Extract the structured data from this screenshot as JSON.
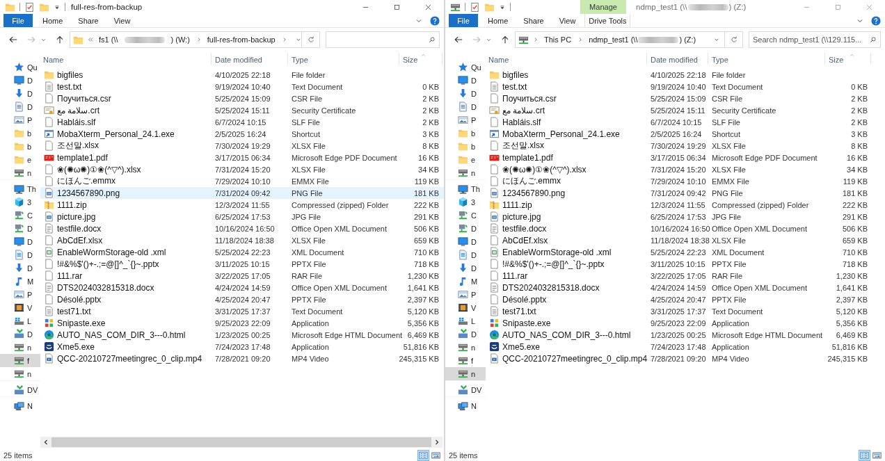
{
  "windows": [
    {
      "kind": "folder",
      "active": true,
      "title": {
        "text_start": "full-res-from-backup"
      },
      "ribbon_tabs": [
        {
          "label": "File",
          "kind": "file"
        },
        {
          "label": "Home",
          "kind": "tab"
        },
        {
          "label": "Share",
          "kind": "tab"
        },
        {
          "label": "View",
          "kind": "tab"
        }
      ],
      "address": {
        "crumbs": [
          {
            "text_start": "fs1 (\\\\",
            "redacted": true,
            "text_end": ") (W:)",
            "chevron_after": true
          },
          {
            "text_start": "full-res-from-backup",
            "redacted": false,
            "chevron_after": true
          }
        ]
      },
      "nav": [
        {
          "label": "Qu",
          "kind": "star",
          "selected": false
        },
        {
          "label": "D",
          "kind": "desktop",
          "selected": false
        },
        {
          "label": "D",
          "kind": "download",
          "selected": false
        },
        {
          "label": "D",
          "kind": "docs",
          "selected": false
        },
        {
          "label": "P",
          "kind": "pictures",
          "selected": false
        },
        {
          "label": "b",
          "kind": "folder",
          "selected": false
        },
        {
          "label": "b",
          "kind": "folder",
          "selected": false
        },
        {
          "label": "e",
          "kind": "folder",
          "selected": false
        },
        {
          "label": "n",
          "kind": "netdrive",
          "selected": false
        },
        {
          "label": "Th",
          "kind": "pc",
          "selected": false,
          "group_start": true
        },
        {
          "label": "3",
          "kind": "cube",
          "selected": false
        },
        {
          "label": "C",
          "kind": "share",
          "selected": false
        },
        {
          "label": "D",
          "kind": "share",
          "selected": false
        },
        {
          "label": "D",
          "kind": "desktop",
          "selected": false
        },
        {
          "label": "D",
          "kind": "docs",
          "selected": false
        },
        {
          "label": "D",
          "kind": "download",
          "selected": false
        },
        {
          "label": "M",
          "kind": "music",
          "selected": false
        },
        {
          "label": "P",
          "kind": "pictures",
          "selected": false
        },
        {
          "label": "V",
          "kind": "video",
          "selected": false
        },
        {
          "label": "L",
          "kind": "local",
          "selected": false
        },
        {
          "label": "D",
          "kind": "dvd",
          "selected": false
        },
        {
          "label": "n",
          "kind": "netdrive",
          "selected": false
        },
        {
          "label": "f",
          "kind": "netdrive",
          "selected": true
        },
        {
          "label": "n",
          "kind": "netdrive",
          "selected": false
        },
        {
          "label": "DV",
          "kind": "dvd",
          "selected": false,
          "group_start": true
        },
        {
          "label": "N",
          "kind": "network",
          "selected": false,
          "group_start": true
        }
      ],
      "columns": [
        {
          "label": "Name",
          "sorted": false
        },
        {
          "label": "Date modified",
          "sorted": false
        },
        {
          "label": "Type",
          "sorted": false
        },
        {
          "label": "Size",
          "sorted": true
        }
      ],
      "rows": [
        {
          "kind": "folder",
          "name": "bigfiles",
          "date": "4/10/2025 22:18",
          "type": "File folder",
          "selected": false
        },
        {
          "kind": "text",
          "name": "test.txt",
          "date": "9/19/2024 10:40",
          "type": "Text Document",
          "size": "0 KB",
          "selected": false
        },
        {
          "kind": "blank",
          "name": "Поучиться.csr",
          "date": "5/25/2024 15:09",
          "type": "CSR File",
          "size": "2 KB",
          "selected": false
        },
        {
          "kind": "cert",
          "name": "سلامة مع.crt",
          "date": "5/25/2024 15:11",
          "type": "Security Certificate",
          "size": "2 KB",
          "selected": false
        },
        {
          "kind": "blank",
          "name": "Habláis.slf",
          "date": "6/7/2024 10:15",
          "type": "SLF File",
          "size": "2 KB",
          "selected": false
        },
        {
          "kind": "shortcut",
          "name": "MobaXterm_Personal_24.1.exe",
          "date": "2/5/2025 16:24",
          "type": "Shortcut",
          "size": "3 KB",
          "selected": false
        },
        {
          "kind": "blank",
          "name": "조선말.xlsx",
          "date": "7/30/2024 19:29",
          "type": "XLSX File",
          "size": "8 KB",
          "selected": false
        },
        {
          "kind": "pdf",
          "name": "template1.pdf",
          "date": "3/17/2015 06:34",
          "type": "Microsoft Edge PDF Document",
          "size": "16 KB",
          "selected": false
        },
        {
          "kind": "blank",
          "name": "❀(✺ω✺)①❀(^▽^).xlsx",
          "date": "7/31/2024 15:20",
          "type": "XLSX File",
          "size": "34 KB",
          "selected": false
        },
        {
          "kind": "blank",
          "name": "にほんご.emmx",
          "date": "7/29/2024 10:10",
          "type": "EMMX File",
          "size": "119 KB",
          "selected": false
        },
        {
          "kind": "image",
          "name": "1234567890.png",
          "date": "7/31/2024 09:42",
          "type": "PNG File",
          "size": "181 KB",
          "selected": true
        },
        {
          "kind": "zip",
          "name": "1111.zip",
          "date": "12/3/2024 11:55",
          "type": "Compressed (zipped) Folder",
          "size": "222 KB",
          "selected": false
        },
        {
          "kind": "image",
          "name": "picture.jpg",
          "date": "6/25/2024 17:53",
          "type": "JPG File",
          "size": "291 KB",
          "selected": false
        },
        {
          "kind": "doc",
          "name": "testfile.docx",
          "date": "10/16/2024 16:50",
          "type": "Office Open XML Document",
          "size": "506 KB",
          "selected": false
        },
        {
          "kind": "blank",
          "name": "AbCdEf.xlsx",
          "date": "11/18/2024 18:38",
          "type": "XLSX File",
          "size": "659 KB",
          "selected": false
        },
        {
          "kind": "xml",
          "name": "EnableWormStorage-old .xml",
          "date": "5/25/2024 22:23",
          "type": "XML Document",
          "size": "710 KB",
          "selected": false
        },
        {
          "kind": "blank",
          "name": "!#&%$'()+-.;=@[]^_`{}~.pptx",
          "date": "3/11/2025 10:15",
          "type": "PPTX File",
          "size": "718 KB",
          "selected": false
        },
        {
          "kind": "blank",
          "name": "111.rar",
          "date": "3/22/2025 17:05",
          "type": "RAR File",
          "size": "1,230 KB",
          "selected": false
        },
        {
          "kind": "doc",
          "name": "DTS2024032815318.docx",
          "date": "4/24/2024 14:59",
          "type": "Office Open XML Document",
          "size": "1,641 KB",
          "selected": false
        },
        {
          "kind": "blank",
          "name": "Désolé.pptx",
          "date": "4/25/2024 20:47",
          "type": "PPTX File",
          "size": "2,397 KB",
          "selected": false
        },
        {
          "kind": "text",
          "name": "test71.txt",
          "date": "3/31/2025 17:37",
          "type": "Text Document",
          "size": "5,120 KB",
          "selected": false
        },
        {
          "kind": "snipaste",
          "name": "Snipaste.exe",
          "date": "9/25/2023 22:09",
          "type": "Application",
          "size": "5,356 KB",
          "selected": false
        },
        {
          "kind": "edge",
          "name": "AUTO_NAS_COM_DIR_3---0.html",
          "date": "1/23/2025 00:25",
          "type": "Microsoft Edge HTML Document",
          "size": "6,469 KB",
          "selected": false
        },
        {
          "kind": "xme",
          "name": "Xme5.exe",
          "date": "7/24/2023 17:48",
          "type": "Application",
          "size": "51,816 KB",
          "selected": false
        },
        {
          "kind": "video",
          "name": "QCC-20210727meetingrec_0_clip.mp4",
          "date": "7/28/2021 09:20",
          "type": "MP4 Video",
          "size": "245,315 KB",
          "selected": false
        }
      ],
      "hscroll": true,
      "status": "25 items",
      "view_buttons": [
        {
          "kind": "details",
          "selected": true
        },
        {
          "kind": "large_icons",
          "selected": false
        }
      ]
    },
    {
      "kind": "drive",
      "active": false,
      "title": {
        "text_start": "ndmp_test1 (\\\\",
        "text_end": ") (Z:)"
      },
      "ribbon_tabs": [
        {
          "label": "File",
          "kind": "file"
        },
        {
          "label": "Home",
          "kind": "tab"
        },
        {
          "label": "Share",
          "kind": "tab"
        },
        {
          "label": "View",
          "kind": "tab"
        },
        {
          "label": "Drive Tools",
          "kind": "tab",
          "context_label": "Manage"
        }
      ],
      "address": {
        "crumbs": [
          {
            "text_start": "This PC",
            "redacted": false,
            "chevron_after": true
          },
          {
            "text_start": "ndmp_test1 (\\\\",
            "redacted": true,
            "text_end": ") (Z:)",
            "chevron_after": false
          }
        ]
      },
      "search": {
        "placeholder": "Search ndmp_test1 (\\\\129.115..."
      },
      "nav": [
        {
          "label": "Qu",
          "kind": "star",
          "selected": false
        },
        {
          "label": "D",
          "kind": "desktop",
          "selected": false
        },
        {
          "label": "D",
          "kind": "download",
          "selected": false
        },
        {
          "label": "D",
          "kind": "docs",
          "selected": false
        },
        {
          "label": "P",
          "kind": "pictures",
          "selected": false
        },
        {
          "label": "b",
          "kind": "folder",
          "selected": false
        },
        {
          "label": "b",
          "kind": "folder",
          "selected": false
        },
        {
          "label": "e",
          "kind": "folder",
          "selected": false
        },
        {
          "label": "n",
          "kind": "netdrive",
          "selected": false
        },
        {
          "label": "Th",
          "kind": "pc",
          "selected": false,
          "group_start": true
        },
        {
          "label": "3",
          "kind": "cube",
          "selected": false
        },
        {
          "label": "C",
          "kind": "share",
          "selected": false
        },
        {
          "label": "D",
          "kind": "share",
          "selected": false
        },
        {
          "label": "D",
          "kind": "desktop",
          "selected": false
        },
        {
          "label": "D",
          "kind": "docs",
          "selected": false
        },
        {
          "label": "D",
          "kind": "download",
          "selected": false
        },
        {
          "label": "M",
          "kind": "music",
          "selected": false
        },
        {
          "label": "P",
          "kind": "pictures",
          "selected": false
        },
        {
          "label": "V",
          "kind": "video",
          "selected": false
        },
        {
          "label": "L",
          "kind": "local",
          "selected": false
        },
        {
          "label": "D",
          "kind": "dvd",
          "selected": false
        },
        {
          "label": "n",
          "kind": "netdrive",
          "selected": false
        },
        {
          "label": "f",
          "kind": "netdrive",
          "selected": false
        },
        {
          "label": "n",
          "kind": "netdrive",
          "selected": true
        },
        {
          "label": "DV",
          "kind": "dvd",
          "selected": false,
          "group_start": true
        },
        {
          "label": "N",
          "kind": "network",
          "selected": false,
          "group_start": true
        }
      ],
      "columns": [
        {
          "label": "Name",
          "sorted": false
        },
        {
          "label": "Date modified",
          "sorted": false
        },
        {
          "label": "Type",
          "sorted": false
        },
        {
          "label": "Size",
          "sorted": true
        }
      ],
      "rows": [
        {
          "kind": "folder",
          "name": "bigfiles",
          "date": "4/10/2025 22:18",
          "type": "File folder",
          "selected": false
        },
        {
          "kind": "text",
          "name": "test.txt",
          "date": "9/19/2024 10:40",
          "type": "Text Document",
          "size": "0 KB",
          "selected": false
        },
        {
          "kind": "blank",
          "name": "Поучиться.csr",
          "date": "5/25/2024 15:09",
          "type": "CSR File",
          "size": "2 KB",
          "selected": false
        },
        {
          "kind": "cert",
          "name": "سلامة مع.crt",
          "date": "5/25/2024 15:11",
          "type": "Security Certificate",
          "size": "2 KB",
          "selected": false
        },
        {
          "kind": "blank",
          "name": "Habláis.slf",
          "date": "6/7/2024 10:15",
          "type": "SLF File",
          "size": "2 KB",
          "selected": false
        },
        {
          "kind": "shortcut",
          "name": "MobaXterm_Personal_24.1.exe",
          "date": "2/5/2025 16:24",
          "type": "Shortcut",
          "size": "3 KB",
          "selected": false
        },
        {
          "kind": "blank",
          "name": "조선말.xlsx",
          "date": "7/30/2024 19:29",
          "type": "XLSX File",
          "size": "8 KB",
          "selected": false
        },
        {
          "kind": "pdf",
          "name": "template1.pdf",
          "date": "3/17/2015 06:34",
          "type": "Microsoft Edge PDF Document",
          "size": "16 KB",
          "selected": false
        },
        {
          "kind": "blank",
          "name": "❀(✺ω✺)①❀(^▽^).xlsx",
          "date": "7/31/2024 15:20",
          "type": "XLSX File",
          "size": "34 KB",
          "selected": false
        },
        {
          "kind": "blank",
          "name": "にほんご.emmx",
          "date": "7/29/2024 10:10",
          "type": "EMMX File",
          "size": "119 KB",
          "selected": false
        },
        {
          "kind": "image",
          "name": "1234567890.png",
          "date": "7/31/2024 09:42",
          "type": "PNG File",
          "size": "181 KB",
          "selected": false
        },
        {
          "kind": "zip",
          "name": "1111.zip",
          "date": "12/3/2024 11:55",
          "type": "Compressed (zipped) Folder",
          "size": "222 KB",
          "selected": false
        },
        {
          "kind": "image",
          "name": "picture.jpg",
          "date": "6/25/2024 17:53",
          "type": "JPG File",
          "size": "291 KB",
          "selected": false
        },
        {
          "kind": "doc",
          "name": "testfile.docx",
          "date": "10/16/2024 16:50",
          "type": "Office Open XML Document",
          "size": "506 KB",
          "selected": false
        },
        {
          "kind": "blank",
          "name": "AbCdEf.xlsx",
          "date": "11/18/2024 18:38",
          "type": "XLSX File",
          "size": "659 KB",
          "selected": false
        },
        {
          "kind": "xml",
          "name": "EnableWormStorage-old .xml",
          "date": "5/25/2024 22:23",
          "type": "XML Document",
          "size": "710 KB",
          "selected": false
        },
        {
          "kind": "blank",
          "name": "!#&%$'()+-.;=@[]^_`{}~.pptx",
          "date": "3/11/2025 10:15",
          "type": "PPTX File",
          "size": "718 KB",
          "selected": false
        },
        {
          "kind": "blank",
          "name": "111.rar",
          "date": "3/22/2025 17:05",
          "type": "RAR File",
          "size": "1,230 KB",
          "selected": false
        },
        {
          "kind": "doc",
          "name": "DTS2024032815318.docx",
          "date": "4/24/2024 14:59",
          "type": "Office Open XML Document",
          "size": "1,641 KB",
          "selected": false
        },
        {
          "kind": "blank",
          "name": "Désolé.pptx",
          "date": "4/25/2024 20:47",
          "type": "PPTX File",
          "size": "2,397 KB",
          "selected": false
        },
        {
          "kind": "text",
          "name": "test71.txt",
          "date": "3/31/2025 17:37",
          "type": "Text Document",
          "size": "5,120 KB",
          "selected": false
        },
        {
          "kind": "snipaste",
          "name": "Snipaste.exe",
          "date": "9/25/2023 22:09",
          "type": "Application",
          "size": "5,356 KB",
          "selected": false
        },
        {
          "kind": "edge",
          "name": "AUTO_NAS_COM_DIR_3---0.html",
          "date": "1/23/2025 00:25",
          "type": "Microsoft Edge HTML Document",
          "size": "6,469 KB",
          "selected": false
        },
        {
          "kind": "xme",
          "name": "Xme5.exe",
          "date": "7/24/2023 17:48",
          "type": "Application",
          "size": "51,816 KB",
          "selected": false
        },
        {
          "kind": "video",
          "name": "QCC-20210727meetingrec_0_clip.mp4",
          "date": "7/28/2021 09:20",
          "type": "MP4 Video",
          "size": "245,315 KB",
          "selected": false
        }
      ],
      "hscroll": false,
      "status": "25 items",
      "view_buttons": [
        {
          "kind": "details",
          "selected": true
        },
        {
          "kind": "large_icons",
          "selected": false
        }
      ]
    }
  ]
}
